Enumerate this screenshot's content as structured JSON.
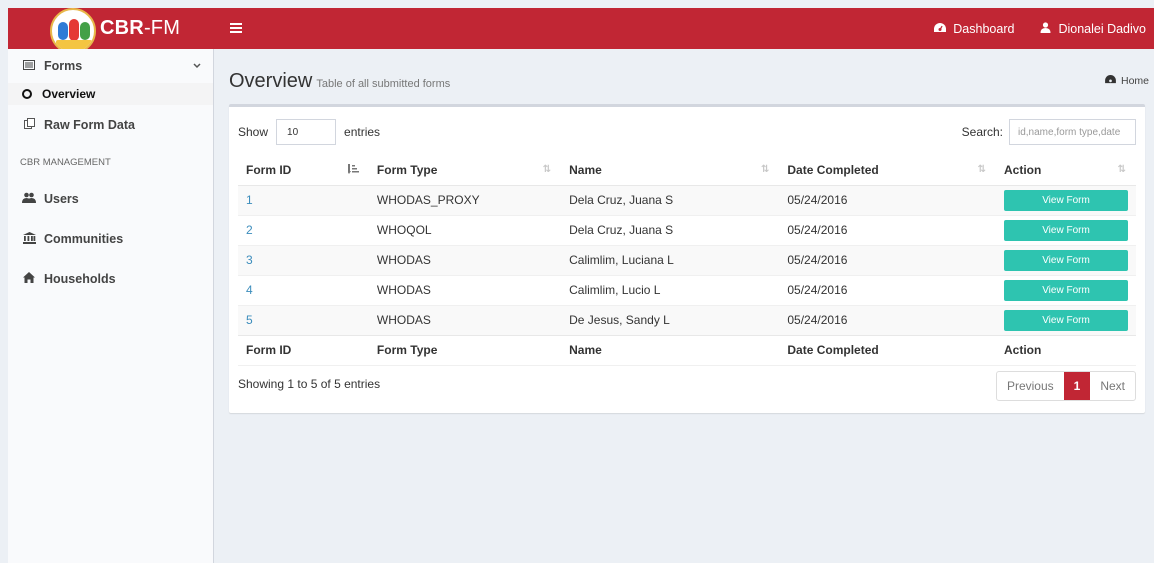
{
  "brand": {
    "bold": "CBR",
    "rest": "-FM"
  },
  "header": {
    "menu_icon": "bars-icon",
    "dashboard_label": "Dashboard",
    "user_name": "Dionalei Dadivo"
  },
  "sidebar": {
    "forms_label": "Forms",
    "overview_label": "Overview",
    "raw_label": "Raw Form Data",
    "section_header": "CBR MANAGEMENT",
    "users_label": "Users",
    "communities_label": "Communities",
    "households_label": "Households"
  },
  "page": {
    "title": "Overview",
    "subtitle": "Table of all submitted forms",
    "breadcrumb_home": "Home"
  },
  "table_controls": {
    "show_label": "Show",
    "entries_value": "10",
    "entries_label": "entries",
    "search_label": "Search:",
    "search_placeholder": "id,name,form type,date"
  },
  "table": {
    "columns": [
      "Form ID",
      "Form Type",
      "Name",
      "Date Completed",
      "Action"
    ],
    "rows": [
      {
        "id": "1",
        "type": "WHODAS_PROXY",
        "name": "Dela Cruz, Juana S",
        "date": "05/24/2016",
        "action": "View Form"
      },
      {
        "id": "2",
        "type": "WHOQOL",
        "name": "Dela Cruz, Juana S",
        "date": "05/24/2016",
        "action": "View Form"
      },
      {
        "id": "3",
        "type": "WHODAS",
        "name": "Calimlim, Luciana L",
        "date": "05/24/2016",
        "action": "View Form"
      },
      {
        "id": "4",
        "type": "WHODAS",
        "name": "Calimlim, Lucio L",
        "date": "05/24/2016",
        "action": "View Form"
      },
      {
        "id": "5",
        "type": "WHODAS",
        "name": "De Jesus, Sandy L",
        "date": "05/24/2016",
        "action": "View Form"
      }
    ]
  },
  "footer": {
    "info": "Showing 1 to 5 of 5 entries",
    "previous": "Previous",
    "current_page": "1",
    "next": "Next"
  },
  "colors": {
    "brand_red": "#c12634",
    "button_teal": "#2ec4b0",
    "link_blue": "#3c8dbc"
  }
}
